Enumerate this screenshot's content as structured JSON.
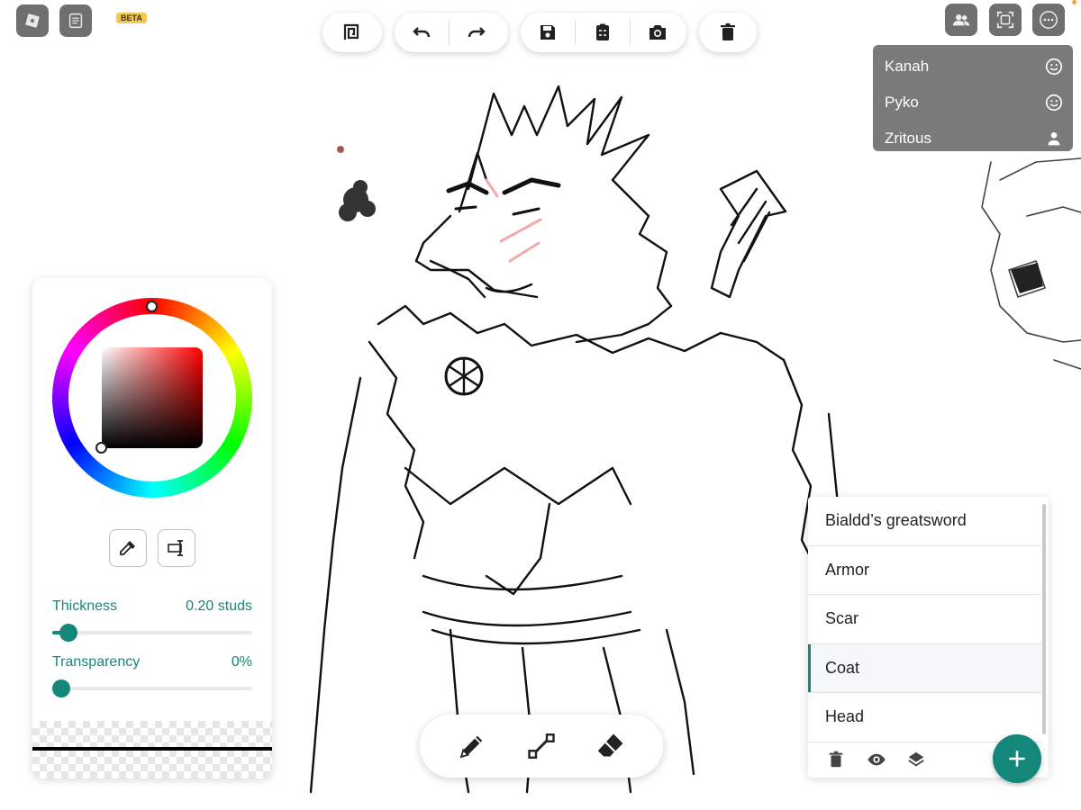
{
  "app": {
    "badge": "BETA",
    "icons": {
      "app_logo": "roblox-logo-icon",
      "notes": "notes-icon",
      "users": "users-icon",
      "fit_screen": "fit-screen-icon",
      "more": "more-icon",
      "select_tool": "select-frame-icon",
      "undo": "undo-icon",
      "redo": "redo-icon",
      "save": "save-icon",
      "clipboard": "clipboard-icon",
      "camera": "camera-icon",
      "trash": "trash-icon",
      "eyedropper": "eyedropper-icon",
      "text_cursor": "text-cursor-icon",
      "pencil": "pencil-icon",
      "line": "line-tool-icon",
      "eraser": "eraser-icon",
      "eye": "eye-icon",
      "layers": "layers-icon",
      "add": "plus-icon"
    }
  },
  "collaborators": [
    {
      "name": "Kanah",
      "icon": "smiley-icon"
    },
    {
      "name": "Pyko",
      "icon": "smiley-icon"
    },
    {
      "name": "Zritous",
      "icon": "person-icon"
    }
  ],
  "color_panel": {
    "thickness_label": "Thickness",
    "thickness_value": "0.20 studs",
    "thickness_fraction": 0.08,
    "transparency_label": "Transparency",
    "transparency_value": "0%",
    "transparency_fraction": 0.0,
    "current_color": "#000000",
    "accent": "#13877a"
  },
  "layers": {
    "items": [
      {
        "name": "Bialdd’s greatsword",
        "active": false
      },
      {
        "name": "Armor",
        "active": false
      },
      {
        "name": "Scar",
        "active": false
      },
      {
        "name": "Coat",
        "active": true
      },
      {
        "name": "Head",
        "active": false
      }
    ]
  }
}
